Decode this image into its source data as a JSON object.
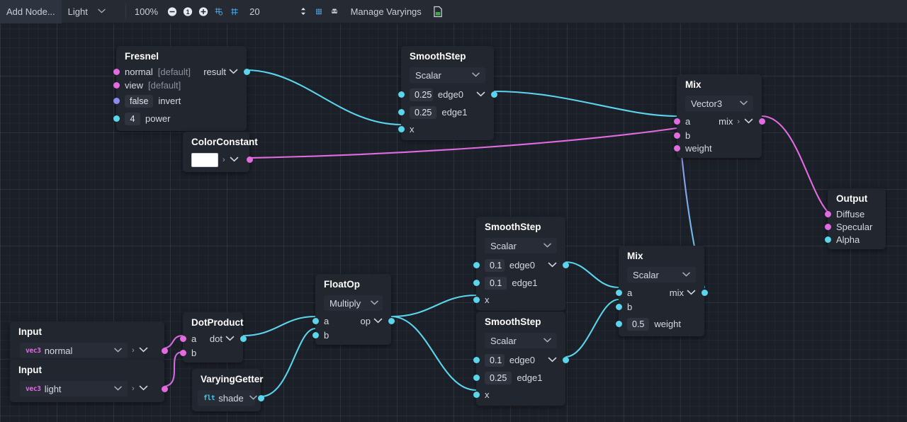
{
  "toolbar": {
    "add_node_label": "Add Node...",
    "preset_label": "Light",
    "preset_caret": "⌄",
    "zoom_label": "100%",
    "zoom_out_icon": "zoom-out-icon",
    "zoom_reset_icon": "zoom-one-to-one-icon",
    "zoom_in_icon": "zoom-in-icon",
    "grid_snap_icon": "grid-snap-icon",
    "grid_show_icon": "grid-show-icon",
    "grid_size_value": "20",
    "sort_icon": "sort-updown-icon",
    "layout_icon": "auto-layout-icon",
    "align_icon": "align-nodes-icon",
    "manage_varyings_label": "Manage Varyings",
    "export_icon": "export-file-icon"
  },
  "nodes": [
    {
      "id": "fresnel",
      "title": "Fresnel",
      "rows": [
        {
          "label": "normal",
          "value": "[default]",
          "out": "result"
        },
        {
          "label": "view",
          "value": "[default]"
        },
        {
          "chip": "false",
          "label": "invert"
        },
        {
          "chip": "4",
          "label": "power"
        }
      ]
    },
    {
      "id": "smoothstep-top",
      "title": "SmoothStep",
      "select": "Scalar",
      "rows": [
        {
          "chip": "0.25",
          "label": "edge0",
          "out": ""
        },
        {
          "chip": "0.25",
          "label": "edge1"
        },
        {
          "label": "x"
        }
      ]
    },
    {
      "id": "colorconstant",
      "title": "ColorConstant",
      "swatch_color": "#ffffff"
    },
    {
      "id": "mix-top",
      "title": "Mix",
      "select": "Vector3",
      "rows": [
        {
          "label": "a",
          "out": "mix"
        },
        {
          "label": "b"
        },
        {
          "label": "weight"
        }
      ]
    },
    {
      "id": "output",
      "title": "Output",
      "rows": [
        {
          "label": "Diffuse"
        },
        {
          "label": "Specular"
        },
        {
          "label": "Alpha"
        }
      ]
    },
    {
      "id": "smoothstep-mid",
      "title": "SmoothStep",
      "select": "Scalar",
      "rows": [
        {
          "chip": "0.1",
          "label": "edge0",
          "out": ""
        },
        {
          "chip": "0.1",
          "label": "edge1"
        },
        {
          "label": "x"
        }
      ]
    },
    {
      "id": "smoothstep-low",
      "title": "SmoothStep",
      "select": "Scalar",
      "rows": [
        {
          "chip": "0.1",
          "label": "edge0",
          "out": ""
        },
        {
          "chip": "0.25",
          "label": "edge1"
        },
        {
          "label": "x"
        }
      ]
    },
    {
      "id": "floatop",
      "title": "FloatOp",
      "select": "Multiply",
      "rows": [
        {
          "label": "a",
          "out": "op"
        },
        {
          "label": "b"
        }
      ]
    },
    {
      "id": "mix-low",
      "title": "Mix",
      "select": "Scalar",
      "rows": [
        {
          "label": "a",
          "out": "mix"
        },
        {
          "label": "b"
        },
        {
          "chip": "0.5",
          "label": "weight"
        }
      ]
    },
    {
      "id": "dotproduct",
      "title": "DotProduct",
      "rows": [
        {
          "label": "a",
          "out": "dot"
        },
        {
          "label": "b"
        }
      ]
    },
    {
      "id": "input-normal",
      "title": "Input",
      "select": "normal",
      "badge": "vec3"
    },
    {
      "id": "input-light",
      "title": "Input",
      "select": "light",
      "badge": "vec3"
    },
    {
      "id": "varyinggetter",
      "title": "VaryingGetter",
      "select": "shade",
      "badge": "flt"
    }
  ],
  "colors": {
    "wire_cyan": "#5bd5ec",
    "wire_pink": "#e06ce0",
    "wire_violet": "#8b8bf0",
    "node_bg": "#22262f",
    "canvas_bg": "#1b1f27",
    "toolbar_bg": "#252a33",
    "accent_blue": "#4a90d9"
  }
}
